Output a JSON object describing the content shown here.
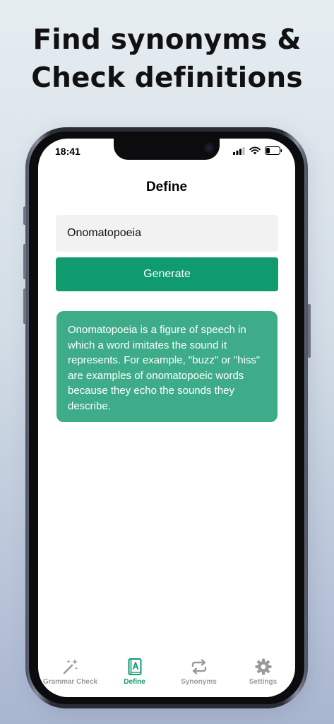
{
  "promo": {
    "headline_line1": "Find synonyms &",
    "headline_line2": "Check definitions"
  },
  "status_bar": {
    "time": "18:41"
  },
  "screen": {
    "title": "Define",
    "input_value": "Onomatopoeia",
    "generate_label": "Generate",
    "result_text": "Onomatopoeia is a figure of speech in which a word imitates the sound it represents. For example, \"buzz\" or \"hiss\" are examples of onomatopoeic words because they echo the sounds they describe."
  },
  "tabbar": {
    "items": [
      {
        "label": "Grammar Check",
        "icon": "magic-wand-icon",
        "active": false
      },
      {
        "label": "Define",
        "icon": "dictionary-icon",
        "active": true
      },
      {
        "label": "Synonyms",
        "icon": "repeat-arrows-icon",
        "active": false
      },
      {
        "label": "Settings",
        "icon": "gear-icon",
        "active": false
      }
    ]
  },
  "colors": {
    "accent": "#0f9b6e",
    "result_card": "#3eac88",
    "inactive_tab": "#9a9a9a",
    "input_bg": "#f2f2f2"
  }
}
